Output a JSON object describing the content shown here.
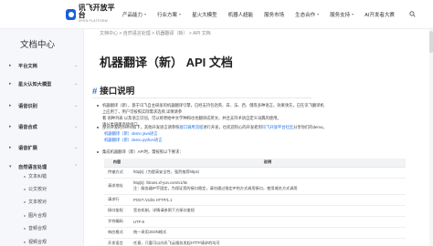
{
  "header": {
    "logo_title": "讯飞开放平台",
    "logo_sub": "OPEN PLATFORM",
    "nav": [
      {
        "label": "产品能力",
        "dropdown": true
      },
      {
        "label": "行业方案",
        "dropdown": true
      },
      {
        "label": "星火大模型",
        "dropdown": false
      },
      {
        "label": "机器人超能",
        "dropdown": false
      },
      {
        "label": "服务市场",
        "dropdown": false
      },
      {
        "label": "生态合作",
        "dropdown": true
      },
      {
        "label": "服务支持",
        "dropdown": true
      },
      {
        "label": "AI开发者大赛",
        "dropdown": false
      }
    ],
    "colors": {
      "brand": "#1a5fd6",
      "link": "#1f6feb"
    }
  },
  "sidebar": {
    "title": "文档中心",
    "items": [
      {
        "label": "平台文档",
        "state": "collapsed"
      },
      {
        "label": "星火认知大模型",
        "state": "collapsed"
      },
      {
        "label": "语音识别",
        "state": "collapsed"
      },
      {
        "label": "语音合成",
        "state": "collapsed"
      },
      {
        "label": "语音扩展",
        "state": "collapsed"
      },
      {
        "label": "自然语言处理",
        "state": "expanded"
      }
    ],
    "subitems": [
      "文本纠错",
      "公文校对",
      "文本校对",
      "图片合规",
      "音频合规",
      "视频合规"
    ]
  },
  "breadcrumb": {
    "items": [
      "文档中心",
      "自然语言处理",
      "机器翻译（新）",
      "API 文档"
    ],
    "separator": ">"
  },
  "page_title": "机器翻译（新） API 文档",
  "section": {
    "hash": "#",
    "title": "接口说明"
  },
  "paragraphs": {
    "p1_line1": "机器翻译（新），基于讯飞自主研发的机器翻译引擎，已经支持包括英、日、法、西、俄等多种语言，效果领先，已在讯飞翻译机上应用了，用户可按照实际需求选择,详情请参",
    "p1_line2": "看 语种列表 以及语言识别。可以将原始中文学种和也也翻译成英文，并且支持术语自定义词典的使用。",
    "p1_line3": "请分类调用高级接口。",
    "p2_prefix": "部分开发的Demo如下，其他开发语言请参照",
    "p2_link1": "接口调用流程",
    "p2_middle": "进行开发，也欢迎热心的开发者到",
    "p2_link2": "讯飞开放平台社区",
    "p2_suffix": "分享你们的demo。",
    "code_links": [
      "机器翻译（新）demo java语言",
      "机器翻译（新）demo python语言"
    ],
    "p3": "集成机器翻译（新）API时，需按照以下要求："
  },
  "table": {
    "headers": [
      "内容",
      "说明"
    ],
    "rows": [
      [
        "传输方式",
        "http[s]（为提高安全性，强烈推荐https）"
      ],
      [
        "请求地址",
        "http[s]: //itrans.xf-yun.com/v1/its\n注：服务器IP不固定，为保证您的接口稳定，请勿通过指定IP的方式调用接口，使用域名方式调用"
      ],
      [
        "请求行",
        "POST /v1/its HTTP/1.1"
      ],
      [
        "接口鉴权",
        "签名机制，详情请参照下方接口鉴权"
      ],
      [
        "字符编码",
        "UTF-8"
      ],
      [
        "响应格式",
        "统一采用JSON格式"
      ],
      [
        "开发语言",
        "任意，只要可以向讯飞云服务发起HTTP请求的均可"
      ]
    ]
  }
}
